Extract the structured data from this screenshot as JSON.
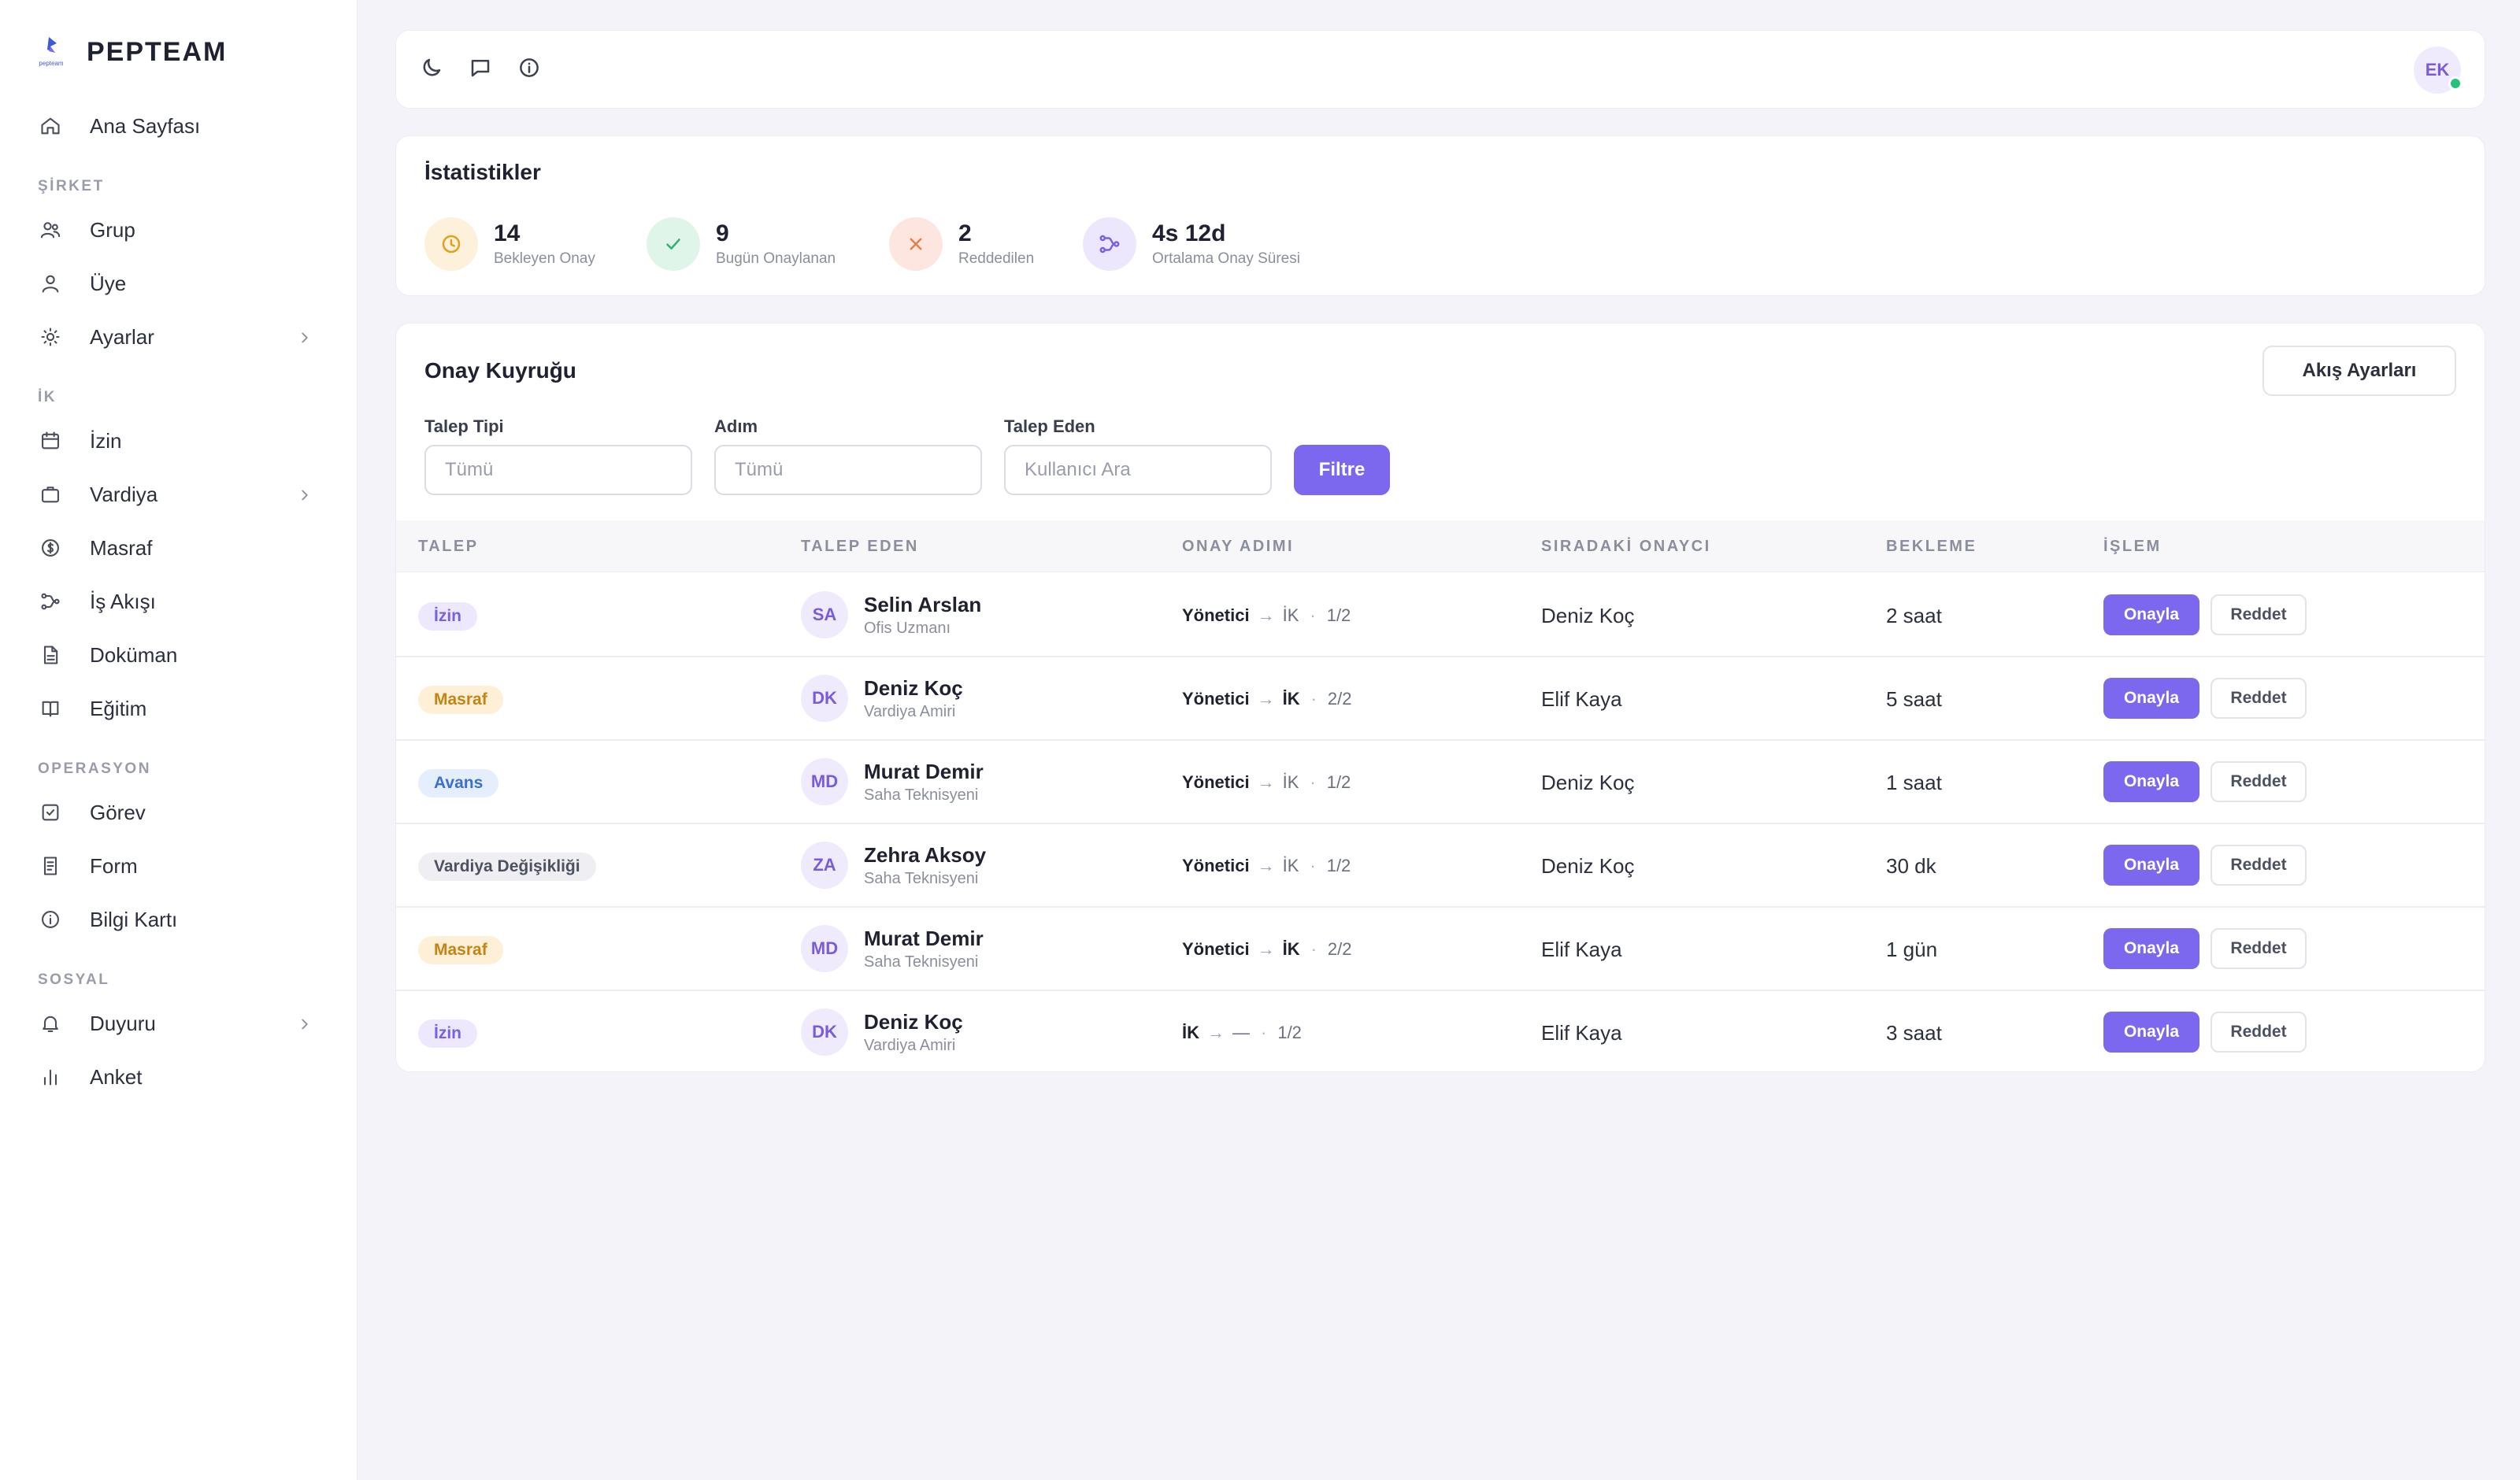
{
  "brand": {
    "name": "PEPTEAM",
    "logo_text": "pepteam"
  },
  "sidebar": {
    "home": {
      "label": "Ana Sayfası",
      "icon": "home-icon"
    },
    "sections": [
      {
        "title": "ŞİRKET",
        "items": [
          {
            "label": "Grup",
            "icon": "users-icon"
          },
          {
            "label": "Üye",
            "icon": "user-icon"
          },
          {
            "label": "Ayarlar",
            "icon": "sun-icon",
            "has_submenu": true
          }
        ]
      },
      {
        "title": "İK",
        "items": [
          {
            "label": "İzin",
            "icon": "calendar-icon"
          },
          {
            "label": "Vardiya",
            "icon": "briefcase-icon",
            "has_submenu": true
          },
          {
            "label": "Masraf",
            "icon": "dollar-circle-icon"
          },
          {
            "label": "İş Akışı",
            "icon": "workflow-icon"
          },
          {
            "label": "Doküman",
            "icon": "document-icon"
          },
          {
            "label": "Eğitim",
            "icon": "book-icon"
          }
        ]
      },
      {
        "title": "OPERASYON",
        "items": [
          {
            "label": "Görev",
            "icon": "checkbox-icon"
          },
          {
            "label": "Form",
            "icon": "form-icon"
          },
          {
            "label": "Bilgi Kartı",
            "icon": "info-icon"
          }
        ]
      },
      {
        "title": "SOSYAL",
        "items": [
          {
            "label": "Duyuru",
            "icon": "bell-icon",
            "has_submenu": true
          },
          {
            "label": "Anket",
            "icon": "bar-chart-icon"
          }
        ]
      }
    ]
  },
  "topbar": {
    "icons": [
      "moon-icon",
      "message-icon",
      "info-icon"
    ],
    "user_initials": "EK",
    "online_color": "#22c17c"
  },
  "stats": {
    "title": "İstatistikler",
    "items": [
      {
        "value": "14",
        "label": "Bekleyen Onay",
        "icon": "clock-icon"
      },
      {
        "value": "9",
        "label": "Bugün Onaylanan",
        "icon": "check-icon"
      },
      {
        "value": "2",
        "label": "Reddedilen",
        "icon": "x-icon"
      },
      {
        "value": "4s 12d",
        "label": "Ortalama Onay Süresi",
        "icon": "workflow-icon"
      }
    ]
  },
  "queue": {
    "title": "Onay Kuyruğu",
    "flow_settings_label": "Akış Ayarları",
    "filters": {
      "request_type": {
        "label": "Talep Tipi",
        "placeholder": "Tümü"
      },
      "step": {
        "label": "Adım",
        "placeholder": "Tümü"
      },
      "requester": {
        "label": "Talep Eden",
        "placeholder": "Kullanıcı Ara"
      },
      "button_label": "Filtre"
    },
    "columns": [
      "TALEP",
      "TALEP EDEN",
      "ONAY ADIMI",
      "SIRADAKİ ONAYCI",
      "BEKLEME",
      "İŞLEM"
    ],
    "approve_label": "Onayla",
    "reject_label": "Reddet",
    "arrow": "→",
    "separator": "·",
    "rows": [
      {
        "type": "İzin",
        "kind": "izin",
        "initials": "SA",
        "name": "Selin Arslan",
        "role": "Ofis Uzmanı",
        "step_from": "Yönetici",
        "step_to": "İK",
        "step_to_done": false,
        "step_count": "1/2",
        "next_approver": "Deniz Koç",
        "wait": "2 saat"
      },
      {
        "type": "Masraf",
        "kind": "masraf",
        "initials": "DK",
        "name": "Deniz Koç",
        "role": "Vardiya Amiri",
        "step_from": "Yönetici",
        "step_to": "İK",
        "step_to_done": true,
        "step_count": "2/2",
        "next_approver": "Elif Kaya",
        "wait": "5 saat"
      },
      {
        "type": "Avans",
        "kind": "avans",
        "initials": "MD",
        "name": "Murat Demir",
        "role": "Saha Teknisyeni",
        "step_from": "Yönetici",
        "step_to": "İK",
        "step_to_done": false,
        "step_count": "1/2",
        "next_approver": "Deniz Koç",
        "wait": "1 saat"
      },
      {
        "type": "Vardiya Değişikliği",
        "kind": "vardiya",
        "initials": "ZA",
        "name": "Zehra Aksoy",
        "role": "Saha Teknisyeni",
        "step_from": "Yönetici",
        "step_to": "İK",
        "step_to_done": false,
        "step_count": "1/2",
        "next_approver": "Deniz Koç",
        "wait": "30 dk"
      },
      {
        "type": "Masraf",
        "kind": "masraf",
        "initials": "MD",
        "name": "Murat Demir",
        "role": "Saha Teknisyeni",
        "step_from": "Yönetici",
        "step_to": "İK",
        "step_to_done": true,
        "step_count": "2/2",
        "next_approver": "Elif Kaya",
        "wait": "1 gün"
      },
      {
        "type": "İzin",
        "kind": "izin",
        "initials": "DK",
        "name": "Deniz Koç",
        "role": "Vardiya Amiri",
        "step_from": "İK",
        "step_to": "—",
        "step_to_done": false,
        "step_count": "1/2",
        "next_approver": "Elif Kaya",
        "wait": "3 saat"
      }
    ]
  },
  "colors": {
    "accent": "#7b68ee",
    "badge_izin": "#ede8fd",
    "badge_masraf": "#fdf0d7",
    "badge_avans": "#e4eefc",
    "badge_vardiya": "#efeff3"
  }
}
